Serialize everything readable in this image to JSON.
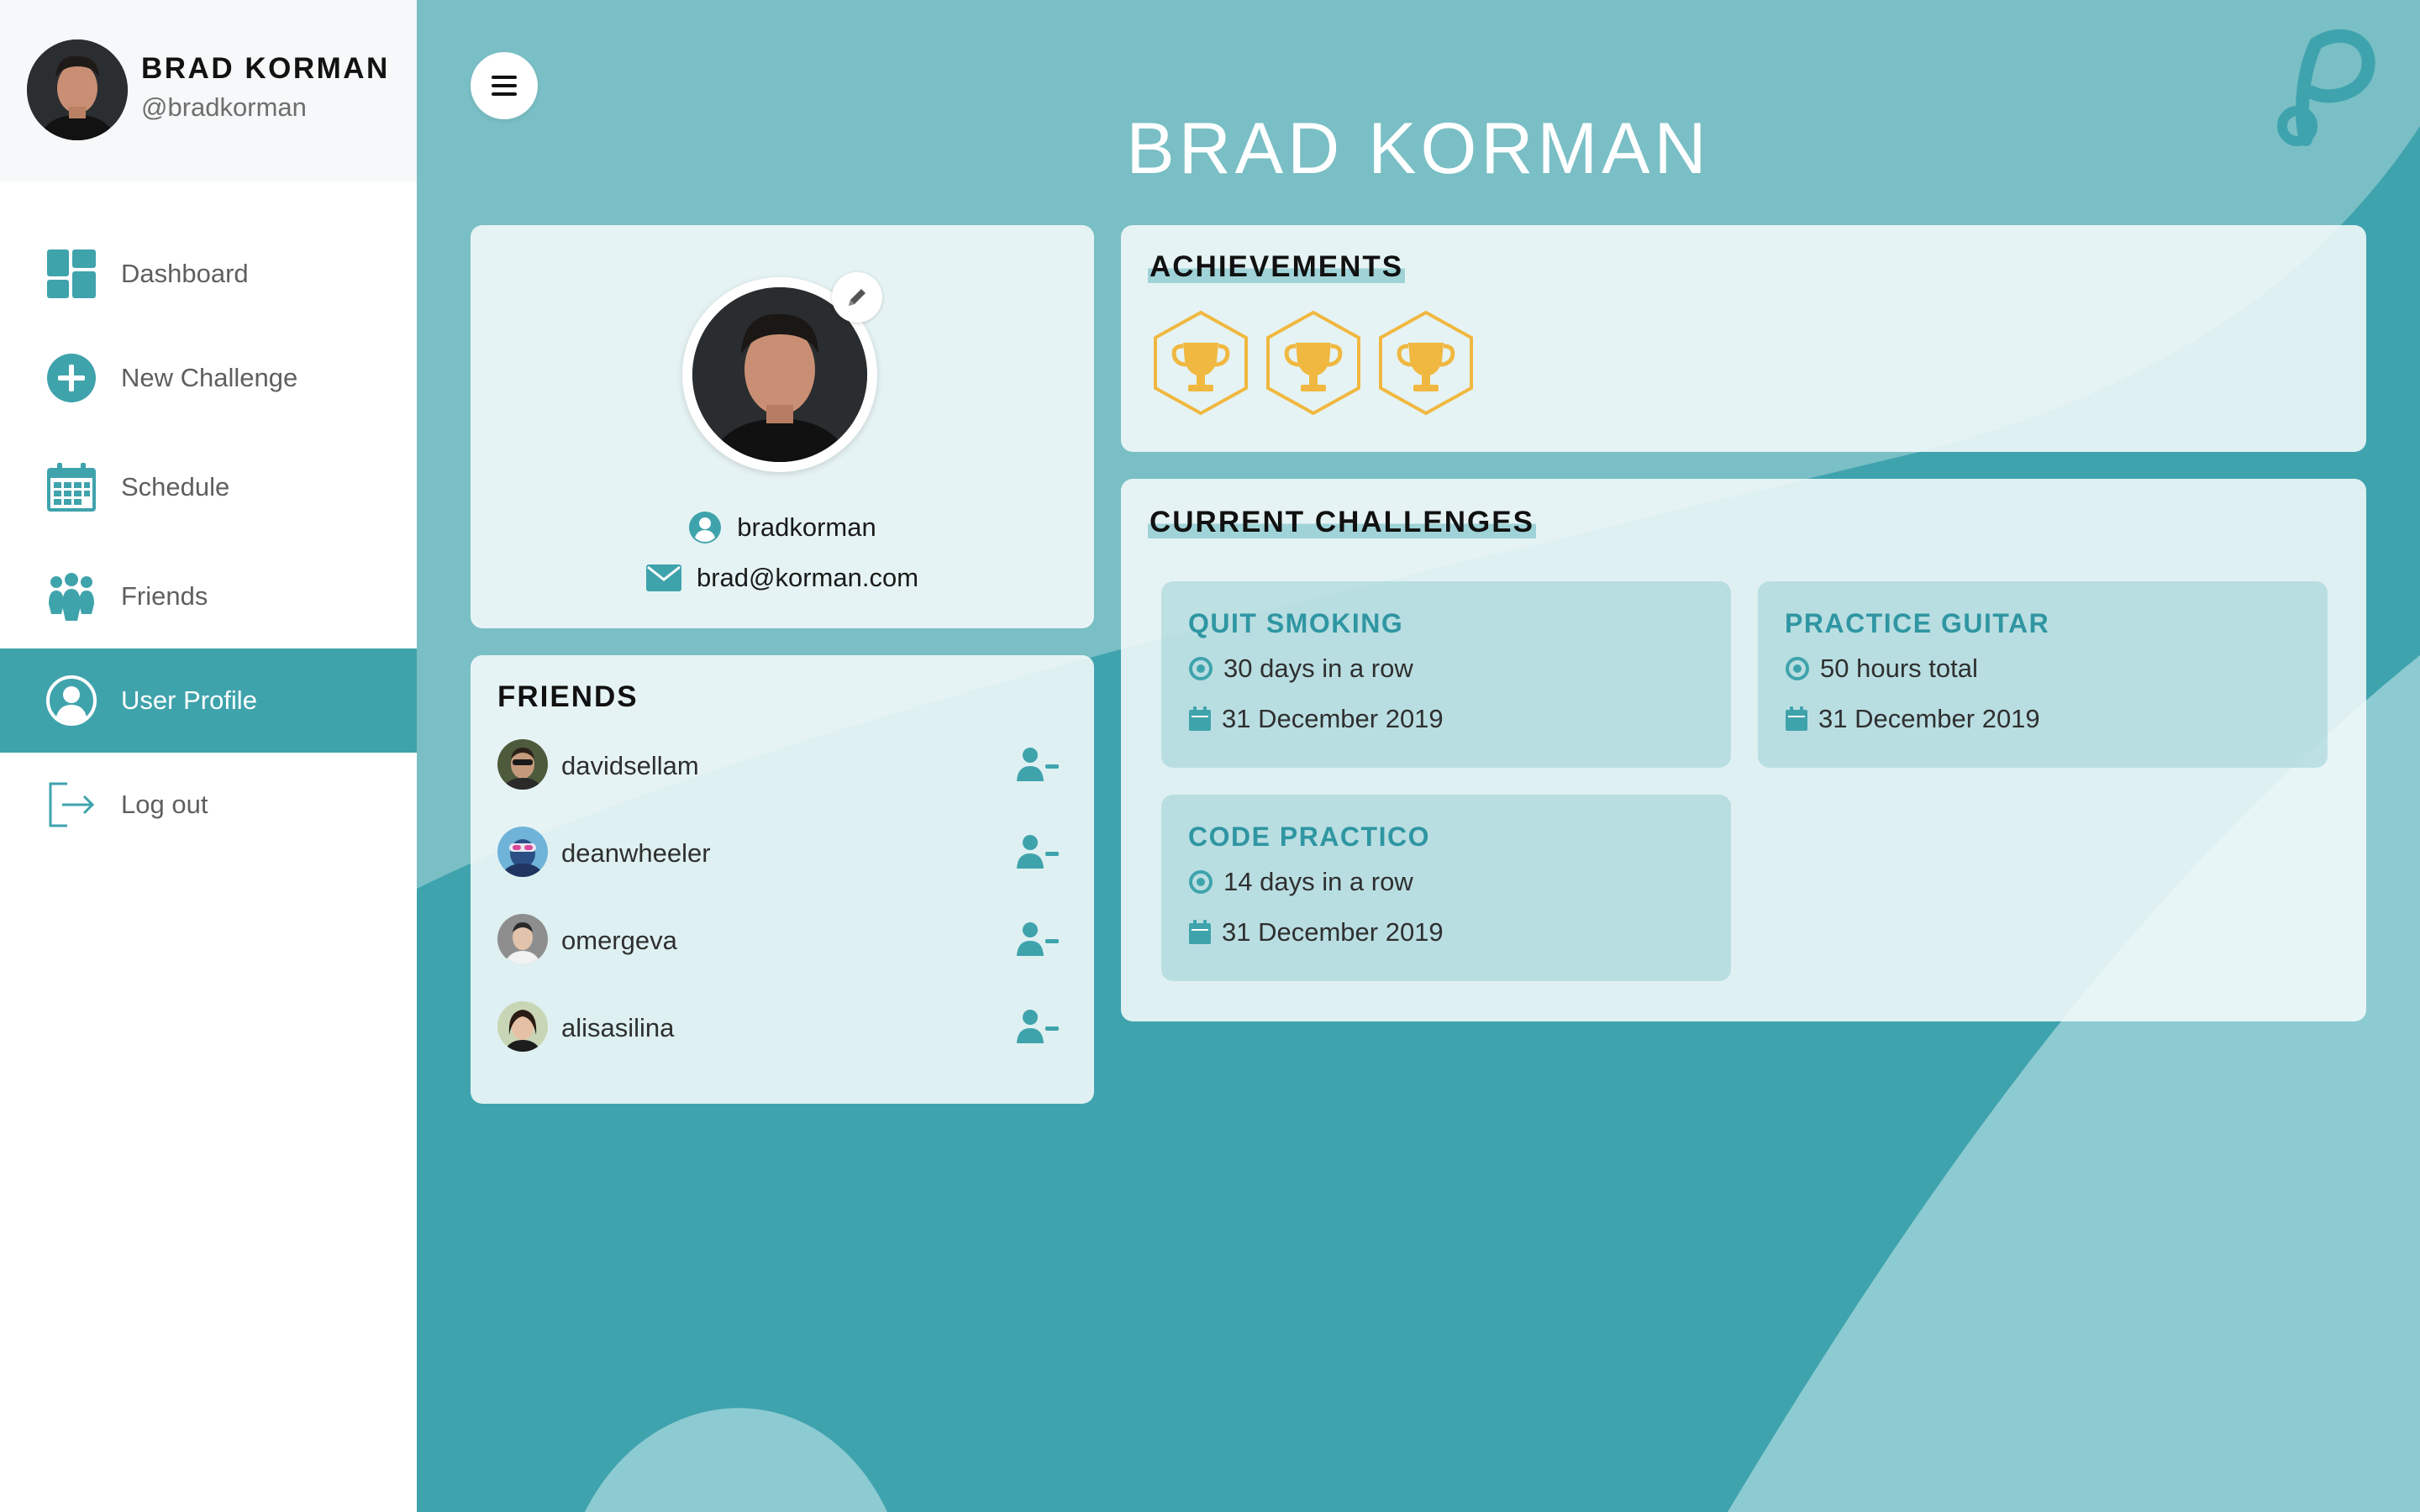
{
  "colors": {
    "accent": "#3fa3ac",
    "background_light": "#79bfc5",
    "background_dark": "#3fa3ae",
    "badge": "#f0b840",
    "challenge_title": "#2f96a2"
  },
  "sidebar": {
    "user": {
      "name": "BRAD KORMAN",
      "handle": "@bradkorman"
    },
    "items": [
      {
        "label": "Dashboard",
        "icon": "dashboard-icon",
        "active": false
      },
      {
        "label": "New Challenge",
        "icon": "plus-circle-icon",
        "active": false
      },
      {
        "label": "Schedule",
        "icon": "calendar-icon",
        "active": false
      },
      {
        "label": "Friends",
        "icon": "friends-icon",
        "active": false
      },
      {
        "label": "User Profile",
        "icon": "user-circle-icon",
        "active": true
      },
      {
        "label": "Log out",
        "icon": "logout-icon",
        "active": false
      }
    ]
  },
  "header": {
    "title": "BRAD KORMAN",
    "menu_icon": "hamburger-icon",
    "logo_icon": "app-logo-p"
  },
  "profile": {
    "username": "bradkorman",
    "email": "brad@korman.com"
  },
  "friends": {
    "title": "FRIENDS",
    "items": [
      {
        "name": "davidsellam"
      },
      {
        "name": "deanwheeler"
      },
      {
        "name": "omergeva"
      },
      {
        "name": "alisasilina"
      }
    ]
  },
  "achievements": {
    "title": "ACHIEVEMENTS",
    "badges": [
      "trophy-icon",
      "trophy-icon",
      "trophy-icon"
    ]
  },
  "challenges": {
    "title": "CURRENT CHALLENGES",
    "items": [
      {
        "title": "QUIT SMOKING",
        "goal": "30 days in a row",
        "date": "31 December 2019"
      },
      {
        "title": "PRACTICE GUITAR",
        "goal": "50 hours total",
        "date": "31 December 2019"
      },
      {
        "title": "CODE PRACTICO",
        "goal": "14 days in a row",
        "date": "31 December 2019"
      }
    ]
  }
}
